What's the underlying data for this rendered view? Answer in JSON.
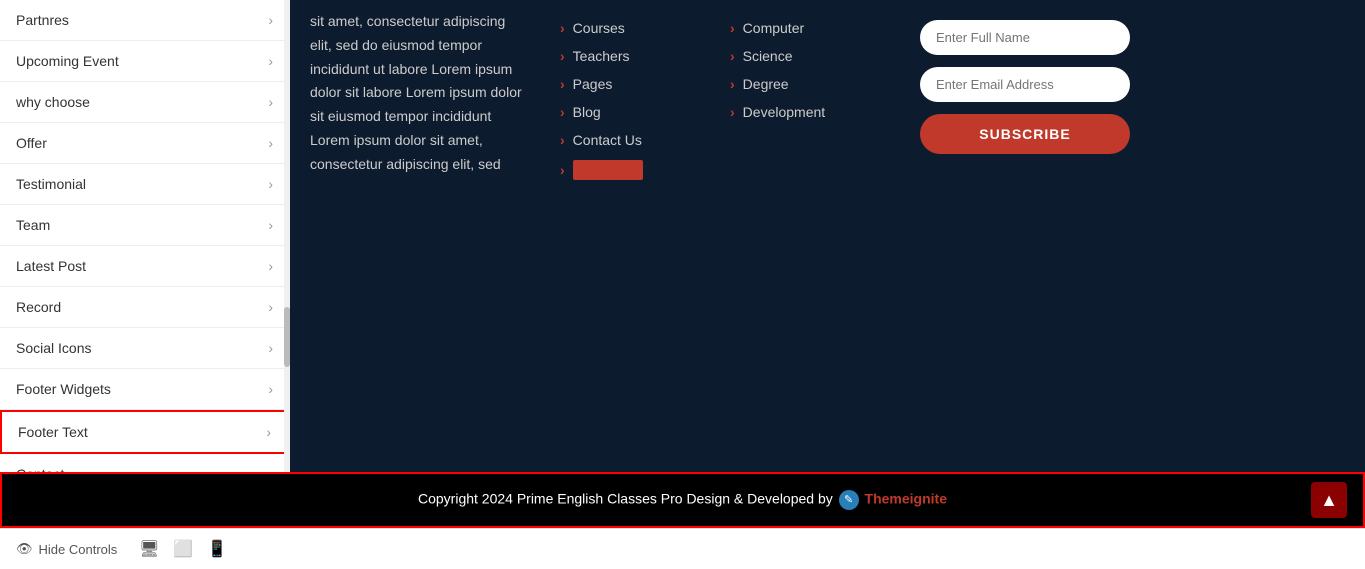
{
  "sidebar": {
    "items": [
      {
        "label": "Partnres",
        "active": false
      },
      {
        "label": "Upcoming Event",
        "active": false
      },
      {
        "label": "why choose",
        "active": false
      },
      {
        "label": "Offer",
        "active": false
      },
      {
        "label": "Testimonial",
        "active": false
      },
      {
        "label": "Team",
        "active": false
      },
      {
        "label": "Latest Post",
        "active": false
      },
      {
        "label": "Record",
        "active": false
      },
      {
        "label": "Social Icons",
        "active": false
      },
      {
        "label": "Footer Widgets",
        "active": false
      },
      {
        "label": "Footer Text",
        "active": true
      },
      {
        "label": "Contact",
        "active": false
      }
    ]
  },
  "content": {
    "text": "sit amet, consectetur adipiscing elit, sed do eiusmod tempor incididunt ut labore Lorem ipsum dolor sit labore Lorem ipsum dolor sit eiusmod tempor incididunt Lorem ipsum dolor sit amet, consectetur adipiscing elit, sed",
    "links": [
      {
        "label": "Courses",
        "blurred": false
      },
      {
        "label": "Teachers",
        "blurred": false
      },
      {
        "label": "Pages",
        "blurred": false
      },
      {
        "label": "Blog",
        "blurred": false
      },
      {
        "label": "Contact Us",
        "blurred": false
      },
      {
        "label": "",
        "blurred": true
      }
    ],
    "courses": [
      {
        "label": "Computer"
      },
      {
        "label": "Science"
      },
      {
        "label": "Degree"
      },
      {
        "label": "Development"
      }
    ]
  },
  "subscribe": {
    "name_placeholder": "Enter Full Name",
    "email_placeholder": "Enter Email Address",
    "button_label": "SUBSCRIBE"
  },
  "footer": {
    "copyright_text": "Copyright 2024 Prime English Classes Pro Design & Developed by",
    "brand": "Themeignite",
    "scroll_top_icon": "▲"
  },
  "bottom_bar": {
    "hide_controls_label": "Hide Controls",
    "desktop_icon": "🖥",
    "tablet_icon": "⬜",
    "mobile_icon": "📱"
  }
}
